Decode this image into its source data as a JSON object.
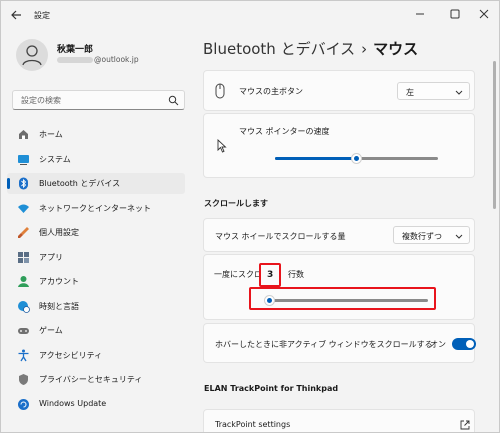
{
  "window": {
    "title": "設定"
  },
  "profile": {
    "name": "秋葉一郎",
    "email_domain": "@outlook.jp"
  },
  "search": {
    "placeholder": "設定の検索"
  },
  "sidebar": {
    "items": [
      {
        "label": "ホーム",
        "icon": "home-icon"
      },
      {
        "label": "システム",
        "icon": "system-icon"
      },
      {
        "label": "Bluetooth とデバイス",
        "icon": "bluetooth-icon",
        "selected": true
      },
      {
        "label": "ネットワークとインターネット",
        "icon": "wifi-icon"
      },
      {
        "label": "個人用設定",
        "icon": "brush-icon"
      },
      {
        "label": "アプリ",
        "icon": "apps-icon"
      },
      {
        "label": "アカウント",
        "icon": "account-icon"
      },
      {
        "label": "時刻と言語",
        "icon": "globe-clock-icon"
      },
      {
        "label": "ゲーム",
        "icon": "gamepad-icon"
      },
      {
        "label": "アクセシビリティ",
        "icon": "accessibility-icon"
      },
      {
        "label": "プライバシーとセキュリティ",
        "icon": "shield-icon"
      },
      {
        "label": "Windows Update",
        "icon": "update-icon"
      }
    ]
  },
  "breadcrumb": {
    "parent": "Bluetooth とデバイス",
    "separator": "›",
    "current": "マウス"
  },
  "main": {
    "primary_button": {
      "label": "マウスの主ボタン",
      "value": "左"
    },
    "pointer_speed": {
      "label": "マウス ポインターの速度",
      "level": 0.5
    },
    "scroll_section": "スクロールします",
    "wheel_scroll": {
      "label": "マウス ホイールでスクロールする量",
      "value": "複数行ずつ"
    },
    "lines_scroll": {
      "label_prefix": "一度にスクロ",
      "label_suffix": "行数",
      "value": "3",
      "level": 0.03
    },
    "inactive_scroll": {
      "label": "ホバーしたときに非アクティブ ウィンドウをスクロールする",
      "state": "オン"
    },
    "trackpoint_section": "ELAN TrackPoint for Thinkpad",
    "trackpoint_settings": {
      "label": "TrackPoint settings"
    }
  },
  "colors": {
    "accent": "#005fb8",
    "highlight": "#e8141c"
  }
}
